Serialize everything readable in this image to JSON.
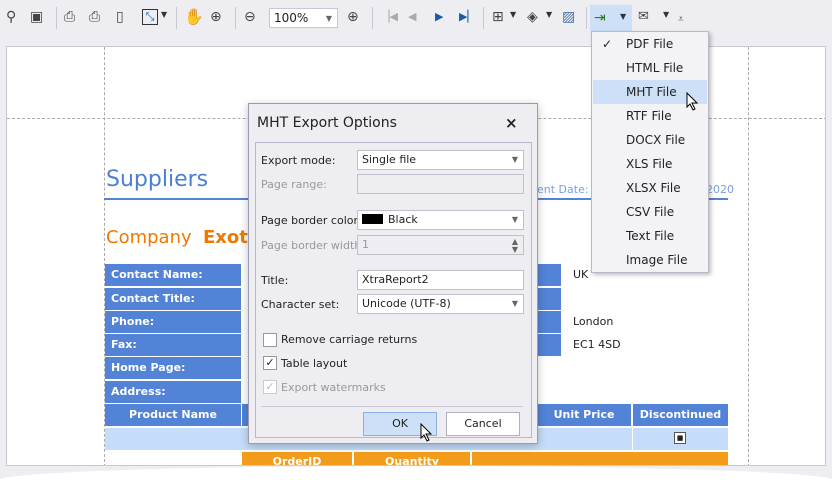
{
  "toolbar": {
    "zoom_value": "100%",
    "icons": [
      "binoculars-icon",
      "save-icon",
      "print-icon",
      "quick-print-icon",
      "page-setup-icon",
      "scale-icon",
      "hand-tool-icon",
      "magnifier-icon",
      "zoom-out-icon",
      "zoom-in-icon",
      "first-page-icon",
      "previous-page-icon",
      "next-page-icon",
      "last-page-icon",
      "multiple-pages-icon",
      "fill-background-icon",
      "watermark-icon",
      "export-icon",
      "email-icon",
      "customize-icon"
    ]
  },
  "export_menu": {
    "items": [
      {
        "label": "PDF File",
        "checked": true
      },
      {
        "label": "HTML File"
      },
      {
        "label": "MHT File",
        "highlighted": true
      },
      {
        "label": "RTF File"
      },
      {
        "label": "DOCX File"
      },
      {
        "label": "XLS File"
      },
      {
        "label": "XLSX File"
      },
      {
        "label": "CSV File"
      },
      {
        "label": "Text File"
      },
      {
        "label": "Image File"
      }
    ]
  },
  "report": {
    "title": "Suppliers",
    "date_label": "ent Date: W",
    "date_year": "2020",
    "company_label": "Company",
    "company_value": "Exoti",
    "fields": [
      "Contact Name:",
      "Contact Title:",
      "Phone:",
      "Fax:",
      "Home Page:",
      "Address:"
    ],
    "values": [
      "UK",
      "",
      "London",
      "EC1 4SD"
    ],
    "product_headers": [
      "Product Name",
      "Unit Price",
      "Discontinued"
    ],
    "order_headers": [
      "OrderID",
      "Quantity"
    ]
  },
  "dialog": {
    "title": "MHT Export Options",
    "close": "×",
    "export_mode_label": "Export mode:",
    "export_mode": "Single file",
    "page_range_label": "Page range:",
    "page_range": "",
    "border_color_label": "Page border color:",
    "border_color": "Black",
    "border_color_swatch": "#000000",
    "border_width_label": "Page border width:",
    "border_width": "1",
    "title_label": "Title:",
    "title_value": "XtraReport2",
    "charset_label": "Character set:",
    "charset": "Unicode (UTF-8)",
    "remove_cr": "Remove carriage returns",
    "remove_cr_checked": false,
    "table_layout": "Table layout",
    "table_layout_checked": true,
    "export_watermarks": "Export watermarks",
    "export_watermarks_checked": true,
    "ok": "OK",
    "cancel": "Cancel"
  },
  "colors": {
    "accent": "#5383d6",
    "orange": "#f39c1c",
    "highlight": "#cde0f7"
  }
}
